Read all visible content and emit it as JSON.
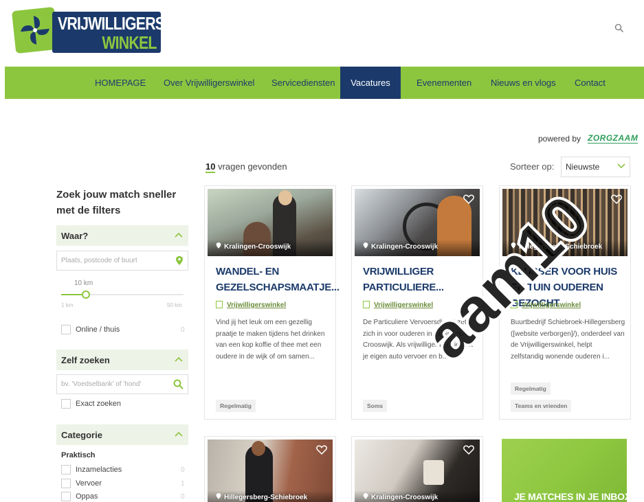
{
  "logo": {
    "line1": "VRIJWILLIGERS",
    "line2": "WINKEL"
  },
  "nav": [
    {
      "label": "HOMEPAGE"
    },
    {
      "label": "Over Vrijwilligerswinkel"
    },
    {
      "label": "Servicediensten"
    },
    {
      "label": "Vacatures",
      "active": true
    },
    {
      "label": "Evenementen"
    },
    {
      "label": "Nieuws en vlogs"
    },
    {
      "label": "Contact"
    }
  ],
  "powered": {
    "label": "powered by",
    "brand": "ZORGZAAM"
  },
  "results": {
    "count": "10",
    "count_suffix": "vragen gevonden",
    "sort_label": "Sorteer op:",
    "sort_value": "Nieuwste"
  },
  "sidebar": {
    "title": "Zoek jouw match sneller met de filters",
    "where": {
      "heading": "Waar?",
      "placeholder": "Plaats, postcode of buurt",
      "radius_value": "10 km",
      "radius_min": "1 km",
      "radius_max": "50 km",
      "online_label": "Online / thuis",
      "online_count": "0"
    },
    "self": {
      "heading": "Zelf zoeken",
      "placeholder": "bv. 'Voedselbank' of 'hond'",
      "exact_label": "Exact zoeken"
    },
    "category": {
      "heading": "Categorie",
      "subheading": "Praktisch",
      "items": [
        {
          "label": "Inzamelacties",
          "count": "0"
        },
        {
          "label": "Vervoer",
          "count": "1"
        },
        {
          "label": "Oppas",
          "count": "0"
        }
      ]
    }
  },
  "cards": [
    {
      "location": "Kralingen-Crooswijk",
      "title": "WANDEL- EN GEZELSCHAPSMAATJE...",
      "org": "Vrijwilligerswinkel",
      "desc": "Vind jij het leuk om een gezellig praatje te maken tijdens het drinken van een kop koffie of thee met een oudere in de wijk of om samen...",
      "tag": "Regelmatig"
    },
    {
      "location": "Kralingen-Crooswijk",
      "title": "VRIJWILLIGER PARTICULIERE...",
      "org": "Vrijwilligerswinkel",
      "desc": "De Particuliere Vervoersdienst zet zich in voor ouderen in Kralingen-Crooswijk. Als vrijwilliger bied je met je eigen auto vervoer en b...",
      "tag": "Soms"
    },
    {
      "location": "Hillegersberg-Schiebroek",
      "title": "KLUSSER VOOR HUIS EN TUIN OUDEREN GEZOCHT",
      "org": "Vrijwilligerswinkel",
      "desc": "Buurtbedrijf Schiebroek-Hillegersberg ([website verborgen]/), onderdeel van de Vrijwilligerswinkel, helpt zelfstandig wonende ouderen i...",
      "tags": [
        "Regelmatig",
        "Teams en vrienden"
      ]
    },
    {
      "location": "Hillegersberg-Schiebroek"
    },
    {
      "location": "Kralingen-Crooswijk"
    },
    {
      "promo": "JE MATCHES IN JE INBOX?"
    }
  ],
  "watermark": "aam10",
  "colors": {
    "green": "#8cc63f",
    "navy": "#1b3a6b"
  }
}
